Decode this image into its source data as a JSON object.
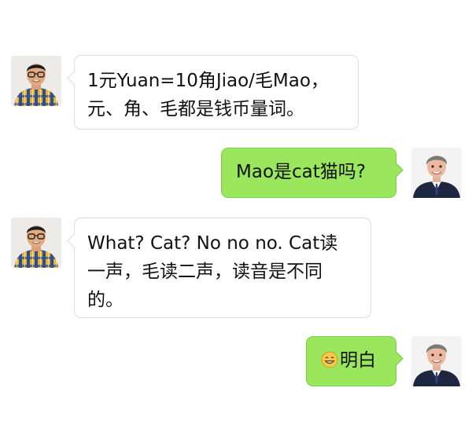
{
  "conversation": {
    "messages": [
      {
        "sender": "teacher",
        "lines": [
          "1元Yuan=10角Jiao/毛Mao，",
          "元、角、毛都是钱币量词。"
        ]
      },
      {
        "sender": "student",
        "lines": [
          "Mao是cat猫吗?"
        ]
      },
      {
        "sender": "teacher",
        "lines": [
          "What?  Cat?  No no no. Cat读",
          "一声，毛读二声，读音是不同",
          "的。"
        ]
      },
      {
        "sender": "student",
        "emoji": "grinning-face-emoji",
        "lines": [
          "明白"
        ]
      }
    ]
  },
  "colors": {
    "incoming_bubble": "#ffffff",
    "outgoing_bubble": "#9ae65c",
    "text": "#111111"
  },
  "icons": {
    "teacher_avatar": "man-with-glasses-plaid-shirt-avatar",
    "student_avatar": "man-in-suit-avatar",
    "emoji": "grinning-face-emoji"
  }
}
